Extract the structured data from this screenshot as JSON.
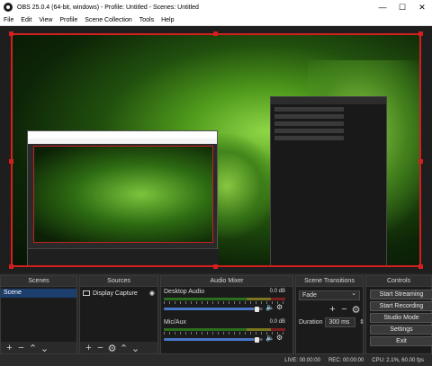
{
  "window": {
    "title": "OBS 25.0.4 (64-bit, windows) - Profile: Untitled - Scenes: Untitled",
    "minimize": "—",
    "maximize": "☐",
    "close": "✕"
  },
  "menu": [
    "File",
    "Edit",
    "View",
    "Profile",
    "Scene Collection",
    "Tools",
    "Help"
  ],
  "docks": {
    "scenes": {
      "title": "Scenes",
      "items": [
        "Scene"
      ]
    },
    "sources": {
      "title": "Sources",
      "items": [
        {
          "name": "Display Capture",
          "icon": "monitor-icon"
        }
      ]
    },
    "mixer": {
      "title": "Audio Mixer",
      "channels": [
        {
          "name": "Desktop Audio",
          "db": "0.0 dB",
          "volume": 1.0
        },
        {
          "name": "Mic/Aux",
          "db": "0.0 dB",
          "volume": 1.0
        }
      ]
    },
    "transitions": {
      "title": "Scene Transitions",
      "selected": "Fade",
      "duration_label": "Duration",
      "duration_value": "300 ms"
    },
    "controls": {
      "title": "Controls",
      "buttons": [
        "Start Streaming",
        "Start Recording",
        "Studio Mode",
        "Settings",
        "Exit"
      ]
    }
  },
  "status": {
    "live": "LIVE: 00:00:00",
    "rec": "REC: 00:00:00",
    "cpu": "CPU: 2.1%, 60.00 fps"
  },
  "colors": {
    "accent": "#d41f1f",
    "selection": "#1d3f6e",
    "panel": "#1f1f1f"
  }
}
